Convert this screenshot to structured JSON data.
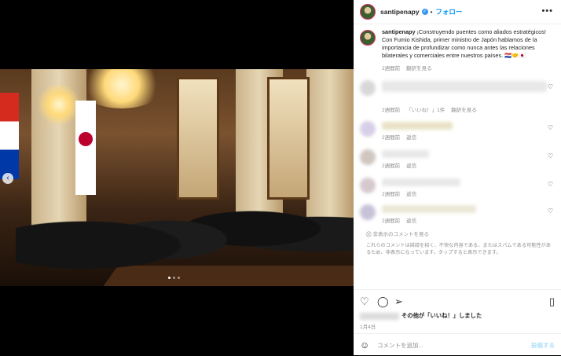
{
  "post": {
    "username": "santipenapy",
    "verified_mark": "✓",
    "follow_label": "フォロー",
    "more_label": "•••"
  },
  "caption": {
    "username": "santipenapy",
    "text": " ¡Construyendo puentes como aliados estratégicos! Con Fumio Kishida, primer ministro de Japón hablamos de la importancia de profundizar como nunca antes las relaciones bilaterales y comerciales entre nuestros países. 🇵🇾🤝🇯🇵",
    "time": "2週間前",
    "translate": "翻訳を見る"
  },
  "comments": [
    {
      "time": "2週間前",
      "likes": "「いいね！」1件",
      "translate": "翻訳を見る"
    },
    {
      "time": "2週間前",
      "reply": "返信"
    },
    {
      "time": "2週間前",
      "reply": "返信"
    },
    {
      "time": "2週間前",
      "reply": "返信"
    },
    {
      "time": "2週間前",
      "reply": "返信"
    }
  ],
  "hidden": {
    "button": "非表示のコメントを見る",
    "note": "これらのコメントは誹謗を招く、不快な内容である、またはスパムである可能性があるため、非表示になっています。タップすると表示できます。"
  },
  "likes": {
    "suffix": "その他が「いいね！」しました"
  },
  "date": "1月4日",
  "add_comment": {
    "placeholder": "コメントを追加...",
    "post_label": "投稿する"
  },
  "icons": {
    "heart": "heart-icon",
    "comment": "comment-icon",
    "share": "share-icon",
    "bookmark": "bookmark-icon",
    "emoji": "emoji-icon",
    "more": "more-icon",
    "verified": "verified-icon",
    "prev": "chevron-left-icon"
  },
  "colors": {
    "accent": "#0095f6",
    "verified": "#3897f0",
    "meta": "#8e8e8e"
  }
}
